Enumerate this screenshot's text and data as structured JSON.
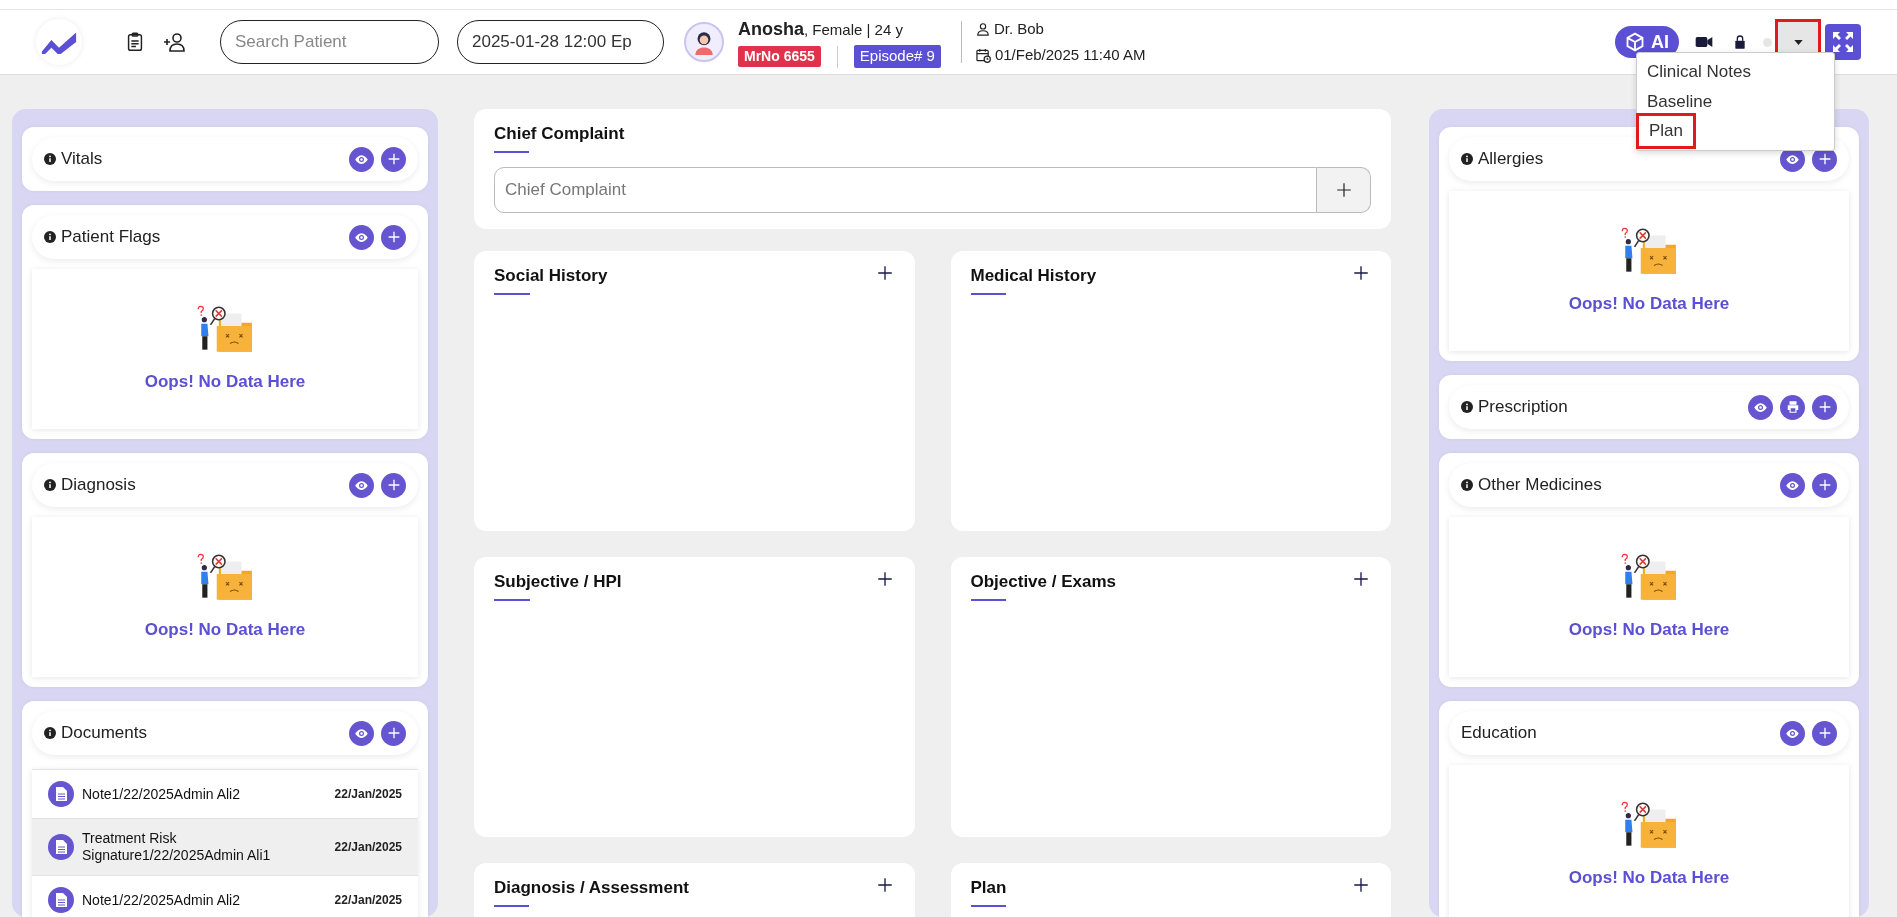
{
  "header": {
    "search": {
      "placeholder": "Search Patient"
    },
    "episode_field": {
      "value": "2025-01-28 12:00 Ep"
    },
    "patient": {
      "name": "Anosha",
      "details": ", Female | 24 y",
      "mrno": "MrNo 6655",
      "episode": "Episode# 9"
    },
    "doctor": {
      "name": "Dr. Bob",
      "datetime": "01/Feb/2025 11:40 AM"
    },
    "ai_button": "AI",
    "dropdown_button": {
      "highlighted": true
    },
    "menu": [
      {
        "label": "Clinical Notes",
        "highlighted": false
      },
      {
        "label": "Baseline",
        "highlighted": false
      },
      {
        "label": "Plan",
        "highlighted": true
      }
    ]
  },
  "left_cards": [
    {
      "title": "Vitals",
      "kind": "plain",
      "info": true,
      "actions": [
        {
          "kind": "view"
        },
        {
          "kind": "add"
        }
      ]
    },
    {
      "title": "Patient Flags",
      "kind": "empty",
      "info": true,
      "actions": [
        {
          "kind": "view"
        },
        {
          "kind": "add"
        }
      ],
      "empty_text": "Oops! No Data Here"
    },
    {
      "title": "Diagnosis",
      "kind": "empty",
      "info": true,
      "actions": [
        {
          "kind": "view"
        },
        {
          "kind": "add"
        }
      ],
      "empty_text": "Oops! No Data Here"
    },
    {
      "title": "Documents",
      "kind": "documents",
      "info": true,
      "actions": [
        {
          "kind": "view"
        },
        {
          "kind": "add"
        }
      ],
      "documents": [
        {
          "name": "Note1/22/2025Admin Ali2",
          "date": "22/Jan/2025",
          "selected": false
        },
        {
          "name": "Treatment Risk Signature1/22/2025Admin Ali1",
          "date": "22/Jan/2025",
          "selected": true
        },
        {
          "name": "Note1/22/2025Admin Ali2",
          "date": "22/Jan/2025",
          "selected": false
        }
      ]
    }
  ],
  "chief_complaint": {
    "title": "Chief Complaint",
    "placeholder": "Chief Complaint"
  },
  "sections": [
    {
      "title": "Social History"
    },
    {
      "title": "Medical History"
    },
    {
      "title": "Subjective / HPI"
    },
    {
      "title": "Objective / Exams"
    },
    {
      "title": "Diagnosis / Assessment"
    },
    {
      "title": "Plan"
    }
  ],
  "right_cards": [
    {
      "title": "Allergies",
      "kind": "empty",
      "info": true,
      "actions": [
        {
          "kind": "view"
        },
        {
          "kind": "add"
        }
      ],
      "empty_text": "Oops! No Data Here"
    },
    {
      "title": "Prescription",
      "kind": "plain",
      "info": true,
      "actions": [
        {
          "kind": "view"
        },
        {
          "kind": "print"
        },
        {
          "kind": "add"
        }
      ]
    },
    {
      "title": "Other Medicines",
      "kind": "empty",
      "info": true,
      "actions": [
        {
          "kind": "view"
        },
        {
          "kind": "add"
        }
      ],
      "empty_text": "Oops! No Data Here"
    },
    {
      "title": "Education",
      "kind": "empty",
      "info": false,
      "actions": [
        {
          "kind": "view"
        },
        {
          "kind": "add"
        }
      ],
      "empty_text": "Oops! No Data Here"
    }
  ]
}
